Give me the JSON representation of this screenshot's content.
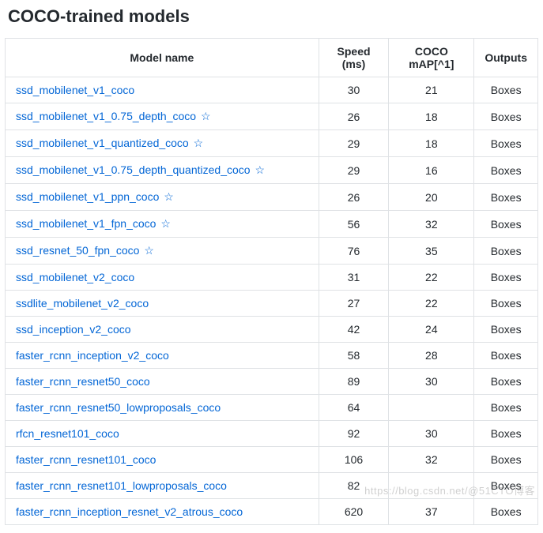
{
  "heading": "COCO-trained models",
  "columns": {
    "model": "Model name",
    "speed": "Speed (ms)",
    "map": "COCO mAP[^1]",
    "outputs": "Outputs"
  },
  "star_glyph": "☆",
  "rows": [
    {
      "name": "ssd_mobilenet_v1_coco",
      "starred": false,
      "speed": "30",
      "map": "21",
      "outputs": "Boxes"
    },
    {
      "name": "ssd_mobilenet_v1_0.75_depth_coco",
      "starred": true,
      "speed": "26",
      "map": "18",
      "outputs": "Boxes"
    },
    {
      "name": "ssd_mobilenet_v1_quantized_coco",
      "starred": true,
      "speed": "29",
      "map": "18",
      "outputs": "Boxes"
    },
    {
      "name": "ssd_mobilenet_v1_0.75_depth_quantized_coco",
      "starred": true,
      "speed": "29",
      "map": "16",
      "outputs": "Boxes"
    },
    {
      "name": "ssd_mobilenet_v1_ppn_coco",
      "starred": true,
      "speed": "26",
      "map": "20",
      "outputs": "Boxes"
    },
    {
      "name": "ssd_mobilenet_v1_fpn_coco",
      "starred": true,
      "speed": "56",
      "map": "32",
      "outputs": "Boxes"
    },
    {
      "name": "ssd_resnet_50_fpn_coco",
      "starred": true,
      "speed": "76",
      "map": "35",
      "outputs": "Boxes"
    },
    {
      "name": "ssd_mobilenet_v2_coco",
      "starred": false,
      "speed": "31",
      "map": "22",
      "outputs": "Boxes"
    },
    {
      "name": "ssdlite_mobilenet_v2_coco",
      "starred": false,
      "speed": "27",
      "map": "22",
      "outputs": "Boxes"
    },
    {
      "name": "ssd_inception_v2_coco",
      "starred": false,
      "speed": "42",
      "map": "24",
      "outputs": "Boxes"
    },
    {
      "name": "faster_rcnn_inception_v2_coco",
      "starred": false,
      "speed": "58",
      "map": "28",
      "outputs": "Boxes"
    },
    {
      "name": "faster_rcnn_resnet50_coco",
      "starred": false,
      "speed": "89",
      "map": "30",
      "outputs": "Boxes"
    },
    {
      "name": "faster_rcnn_resnet50_lowproposals_coco",
      "starred": false,
      "speed": "64",
      "map": "",
      "outputs": "Boxes"
    },
    {
      "name": "rfcn_resnet101_coco",
      "starred": false,
      "speed": "92",
      "map": "30",
      "outputs": "Boxes"
    },
    {
      "name": "faster_rcnn_resnet101_coco",
      "starred": false,
      "speed": "106",
      "map": "32",
      "outputs": "Boxes"
    },
    {
      "name": "faster_rcnn_resnet101_lowproposals_coco",
      "starred": false,
      "speed": "82",
      "map": "",
      "outputs": "Boxes"
    },
    {
      "name": "faster_rcnn_inception_resnet_v2_atrous_coco",
      "starred": false,
      "speed": "620",
      "map": "37",
      "outputs": "Boxes"
    }
  ],
  "watermark": "https://blog.csdn.net/@51CTO博客"
}
